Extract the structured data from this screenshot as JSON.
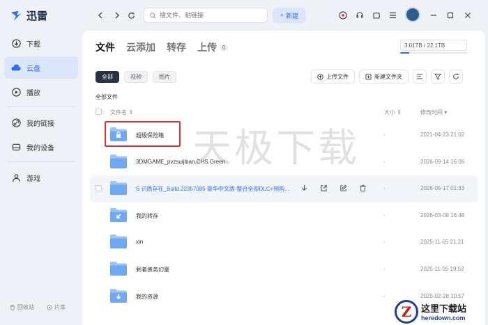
{
  "app": {
    "name": "迅雷"
  },
  "sidebar": {
    "items": [
      {
        "label": "下载",
        "icon": "download-icon",
        "active": false
      },
      {
        "label": "云盘",
        "icon": "cloud-icon",
        "active": true
      },
      {
        "label": "播放",
        "icon": "play-icon",
        "active": false
      },
      {
        "label": "我的链接",
        "icon": "link-icon",
        "active": false
      },
      {
        "label": "我的设备",
        "icon": "device-icon",
        "active": false
      },
      {
        "label": "游戏",
        "icon": "game-icon",
        "active": false
      }
    ],
    "bottom": {
      "recycle": "回收站",
      "library": "片库"
    }
  },
  "topbar": {
    "search_placeholder": "搜文件、贴链接",
    "new_label": "新建"
  },
  "main": {
    "tabs": [
      {
        "label": "文件",
        "active": true
      },
      {
        "label": "云添加",
        "active": false
      },
      {
        "label": "转存",
        "active": false
      },
      {
        "label": "上传",
        "active": false,
        "count": "0"
      }
    ],
    "storage": {
      "text": "3.01TB / 22.1TB",
      "used_fraction": 0.136
    },
    "filters": [
      "全部",
      "视频",
      "图片"
    ],
    "actions": {
      "upload": "上传文件",
      "new_folder": "新建文件夹"
    },
    "breadcrumb": "全部文件",
    "columns": {
      "name": "文件名",
      "size": "大小",
      "time": "修改时间"
    },
    "files": [
      {
        "name": "超级保险箱",
        "size": "-",
        "time": "2021-04-23 21:02",
        "kind": "locked"
      },
      {
        "name": "3DMGAME_pvzsuijiban.CHS.Green",
        "size": "-",
        "time": "2026-09-14 16:06",
        "kind": "folder"
      },
      {
        "name": "S 识质存在_Build.22357085 豪华中文版-整合全部DLC+预购...",
        "size": "-",
        "time": "2026-05-17 01:33",
        "kind": "folder"
      },
      {
        "name": "我的转存",
        "size": "-",
        "time": "2026-03-08 16:48",
        "kind": "transfer"
      },
      {
        "name": "xin",
        "size": "-",
        "time": "2025-11-05 21:21",
        "kind": "folder"
      },
      {
        "name": "剩者债务幻量",
        "size": "-",
        "time": "2025-11-05 19:52",
        "kind": "folder"
      },
      {
        "name": "我的资源",
        "size": "-",
        "time": "2025-02-28 10:57",
        "kind": "download"
      }
    ]
  },
  "watermark": "天极下载",
  "site_badge": {
    "cn": "这里下载站",
    "url": "heredown.com",
    "logo_letter": "Z"
  },
  "colors": {
    "accent": "#2b6ff0",
    "folder": "#7fb2f5",
    "highlight": "#e03030"
  }
}
